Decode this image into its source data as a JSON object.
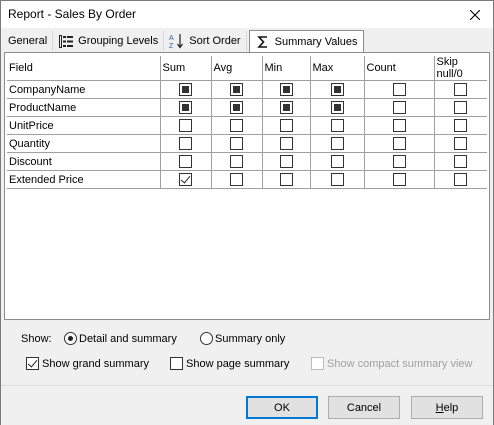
{
  "window": {
    "title": "Report - Sales By Order"
  },
  "tabs": [
    {
      "label": "General",
      "icon": "none"
    },
    {
      "label": "Grouping Levels",
      "icon": "grouping-levels-icon"
    },
    {
      "label": "Sort Order",
      "icon": "sort-az-icon"
    },
    {
      "label": "Summary Values",
      "icon": "sigma-icon",
      "active": true
    }
  ],
  "grid": {
    "headers": [
      "Field",
      "Sum",
      "Avg",
      "Min",
      "Max",
      "Count",
      "Skip null/0"
    ],
    "rows": [
      {
        "field": "CompanyName",
        "states": [
          "filled",
          "filled",
          "filled",
          "filled",
          "empty",
          "empty"
        ]
      },
      {
        "field": "ProductName",
        "states": [
          "filled",
          "filled",
          "filled",
          "filled",
          "empty",
          "empty"
        ]
      },
      {
        "field": "UnitPrice",
        "states": [
          "empty",
          "empty",
          "empty",
          "empty",
          "empty",
          "empty"
        ]
      },
      {
        "field": "Quantity",
        "states": [
          "empty",
          "empty",
          "empty",
          "empty",
          "empty",
          "empty"
        ]
      },
      {
        "field": "Discount",
        "states": [
          "empty",
          "empty",
          "empty",
          "empty",
          "empty",
          "empty"
        ]
      },
      {
        "field": "Extended Price",
        "states": [
          "checked",
          "empty",
          "empty",
          "empty",
          "empty",
          "empty"
        ]
      }
    ]
  },
  "options": {
    "show_label": "Show:",
    "radio_detail": "Detail and summary",
    "radio_summary_only": "Summary only",
    "selected_radio": "detail",
    "show_grand_summary": "Show grand summary",
    "show_grand_summary_checked": true,
    "show_page_summary": "Show page summary",
    "show_page_summary_checked": false,
    "show_compact": "Show compact summary view",
    "show_compact_checked": false,
    "show_compact_disabled": true
  },
  "buttons": {
    "ok": "OK",
    "cancel": "Cancel",
    "help": "Help",
    "help_mnemonic": "H"
  }
}
